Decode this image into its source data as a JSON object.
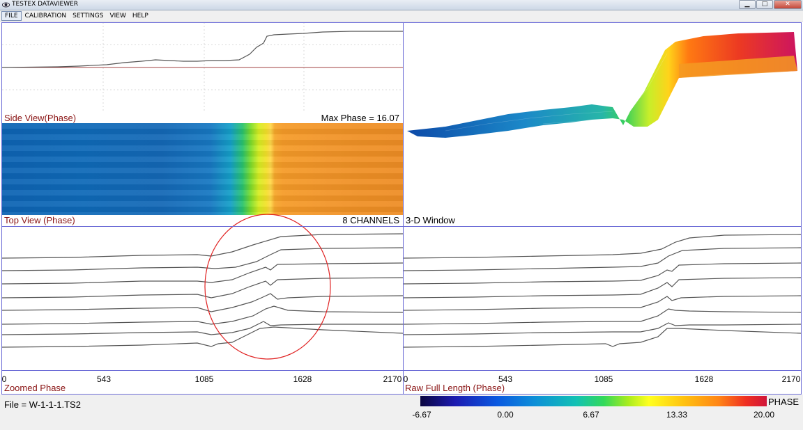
{
  "window": {
    "title": "TESTEX DATAVIEWER"
  },
  "menu": {
    "items": [
      "FILE",
      "CALIBRATION",
      "SETTINGS",
      "VIEW",
      "HELP"
    ]
  },
  "side_view": {
    "label": "Side View(Phase)",
    "max_phase_text": "Max Phase = 16.07"
  },
  "top_view": {
    "label": "Top View (Phase)",
    "channels_text": "8 CHANNELS"
  },
  "window3d": {
    "label": "3-D Window"
  },
  "zoomed": {
    "label": "Zoomed Phase",
    "ticks": [
      "0",
      "543",
      "1085",
      "1628",
      "2170"
    ]
  },
  "raw": {
    "label": "Raw Full Length (Phase)",
    "ticks": [
      "0",
      "543",
      "1085",
      "1628",
      "2170"
    ]
  },
  "status": {
    "file_text": "File = W-1-1-1.TS2"
  },
  "colorbar": {
    "title": "PHASE",
    "ticks": [
      "-6.67",
      "0.00",
      "6.67",
      "13.33",
      "20.00"
    ]
  },
  "colors": {
    "frame": "#6b6bd6",
    "label_red": "#8a1414",
    "trace": "#555555",
    "annotation_circle": "#e02020"
  }
}
